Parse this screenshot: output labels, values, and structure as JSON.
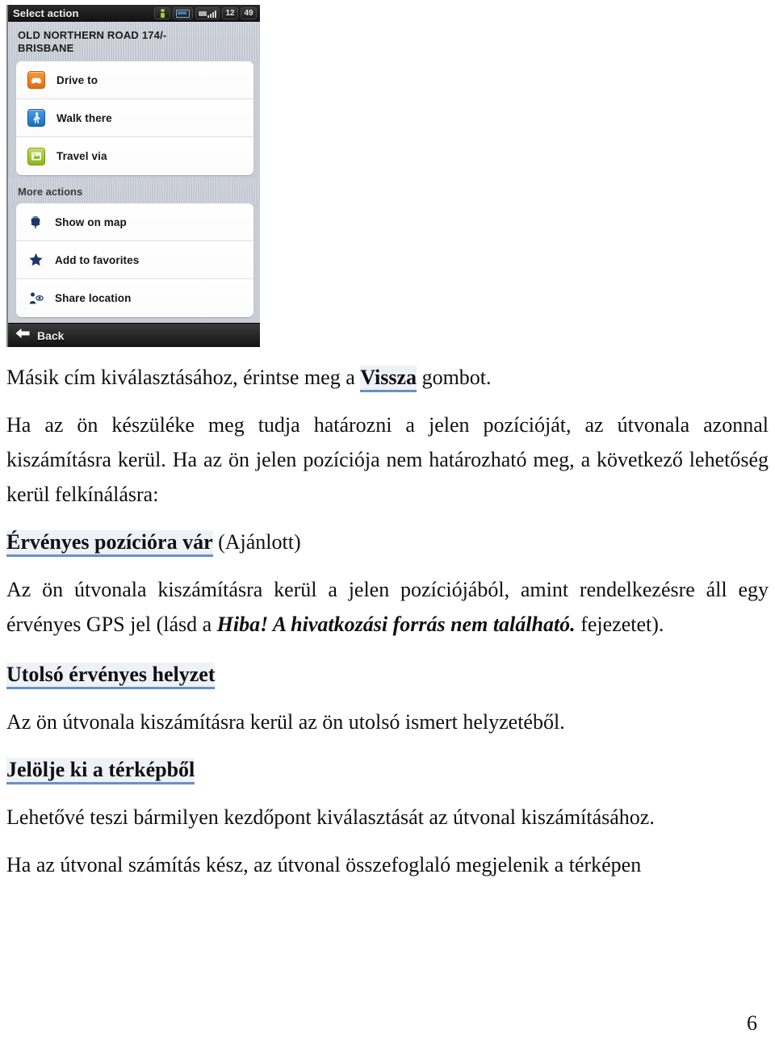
{
  "screenshot": {
    "status_bar": {
      "title": "Select action",
      "icons": [
        "gps-person-icon",
        "battery-icon",
        "signal-bars-icon"
      ],
      "hour": "12",
      "minute": "49"
    },
    "address": {
      "line1": "OLD NORTHERN ROAD 174/-",
      "line2": "BRISBANE"
    },
    "primary_actions": [
      {
        "label": "Drive to",
        "icon": "car-icon"
      },
      {
        "label": "Walk there",
        "icon": "pedestrian-icon"
      },
      {
        "label": "Travel via",
        "icon": "waypoint-icon"
      }
    ],
    "more_actions_label": "More actions",
    "more_actions": [
      {
        "label": "Show on map",
        "icon": "map-pin-icon"
      },
      {
        "label": "Add to favorites",
        "icon": "star-icon"
      },
      {
        "label": "Share location",
        "icon": "share-person-icon"
      }
    ],
    "back_button": {
      "label": "Back",
      "icon": "arrow-left-icon"
    },
    "colors": {
      "drive_icon": "#e06e12",
      "walk_icon": "#1c6fbe",
      "via_icon": "#8fb621",
      "dark_bar": "#141414",
      "panel_bg": "#c6cad3"
    }
  },
  "document": {
    "paragraphs": {
      "p1_pre": "Másik cím kiválasztásához, érintse meg a ",
      "p1_link": "Vissza",
      "p1_post": " gombot.",
      "p2": "Ha az ön készüléke meg tudja határozni a jelen pozícióját, az útvonala azonnal kiszámításra kerül. Ha az ön jelen pozíciója nem határozható meg, a következő lehetőség kerül felkínálásra:",
      "h1_link": "Érvényes pozícióra vár",
      "h1_rest": " (Ajánlott)",
      "p3_pre": "Az ön útvonala kiszámításra kerül a jelen pozíciójából, amint rendelkezésre áll egy érvényes GPS jel (lásd a ",
      "p3_err": "Hiba! A hivatkozási forrás nem található.",
      "p3_post": " fejezetet).",
      "h2_link": "Utolsó érvényes helyzet",
      "p4": "Az ön útvonala kiszámításra kerül az ön utolsó ismert helyzetéből.",
      "h3_link": "Jelölje ki a térképből",
      "p5": "Lehetővé teszi bármilyen kezdőpont kiválasztását az útvonal kiszámításához.",
      "p6": "Ha az útvonal számítás kész, az útvonal összefoglaló megjelenik a térképen"
    },
    "page_number": "6",
    "colors": {
      "link_underline": "#6b8fc4",
      "link_highlight": "#eef1f8",
      "text": "#101010"
    }
  }
}
